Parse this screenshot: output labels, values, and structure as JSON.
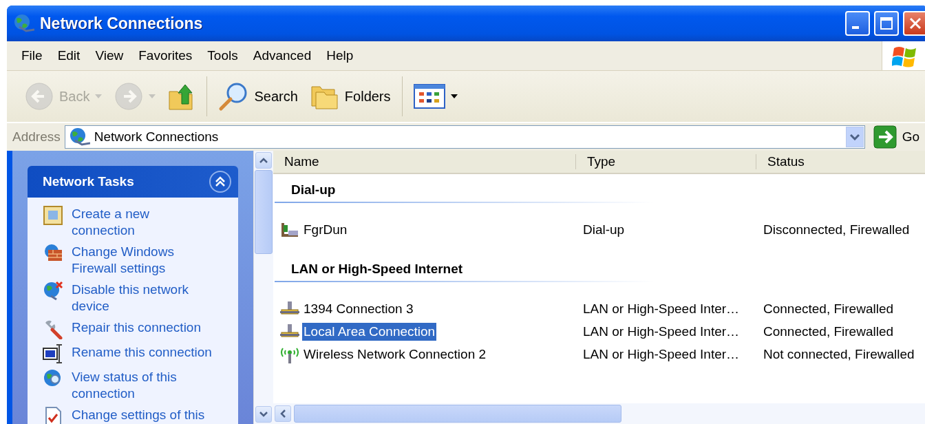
{
  "window": {
    "title": "Network Connections"
  },
  "menu": [
    {
      "label": "File"
    },
    {
      "label": "Edit"
    },
    {
      "label": "View"
    },
    {
      "label": "Favorites"
    },
    {
      "label": "Tools"
    },
    {
      "label": "Advanced"
    },
    {
      "label": "Help"
    }
  ],
  "toolbar": [
    {
      "kind": "back",
      "label": "Back",
      "disabled": true
    },
    {
      "kind": "forward",
      "disabled": true
    },
    {
      "kind": "up",
      "disabled": false
    },
    {
      "kind": "search",
      "label": "Search",
      "disabled": false
    },
    {
      "kind": "folders",
      "label": "Folders",
      "disabled": false
    },
    {
      "kind": "views",
      "disabled": false
    }
  ],
  "address": {
    "label": "Address",
    "value": "Network Connections",
    "go_label": "Go"
  },
  "task_panel": {
    "title": "Network Tasks",
    "expanded": true,
    "items": [
      {
        "kind": "new",
        "label": "Create a new connection"
      },
      {
        "kind": "firewall",
        "label": "Change Windows Firewall settings"
      },
      {
        "kind": "disable",
        "label": "Disable this network device"
      },
      {
        "kind": "repair",
        "label": "Repair this connection"
      },
      {
        "kind": "rename",
        "label": "Rename this connection"
      },
      {
        "kind": "status",
        "label": "View status of this connection"
      },
      {
        "kind": "settings",
        "label": "Change settings of this"
      }
    ]
  },
  "list": {
    "columns": [
      "Name",
      "Type",
      "Status"
    ],
    "groups": [
      {
        "title": "Dial-up",
        "rows": [
          {
            "kind": "dialup",
            "name": "FgrDun",
            "type": "Dial-up",
            "status": "Disconnected, Firewalled",
            "selected": false
          }
        ]
      },
      {
        "title": "LAN or High-Speed Internet",
        "rows": [
          {
            "kind": "lan",
            "name": "1394 Connection 3",
            "type": "LAN or High-Speed Inter…",
            "status": "Connected, Firewalled",
            "selected": false
          },
          {
            "kind": "lan",
            "name": "Local Area Connection",
            "type": "LAN or High-Speed Inter…",
            "status": "Connected, Firewalled",
            "selected": true
          },
          {
            "kind": "wireless",
            "name": "Wireless Network Connection 2",
            "type": "LAN or High-Speed Inter…",
            "status": "Not connected, Firewalled",
            "selected": false
          }
        ]
      }
    ]
  }
}
